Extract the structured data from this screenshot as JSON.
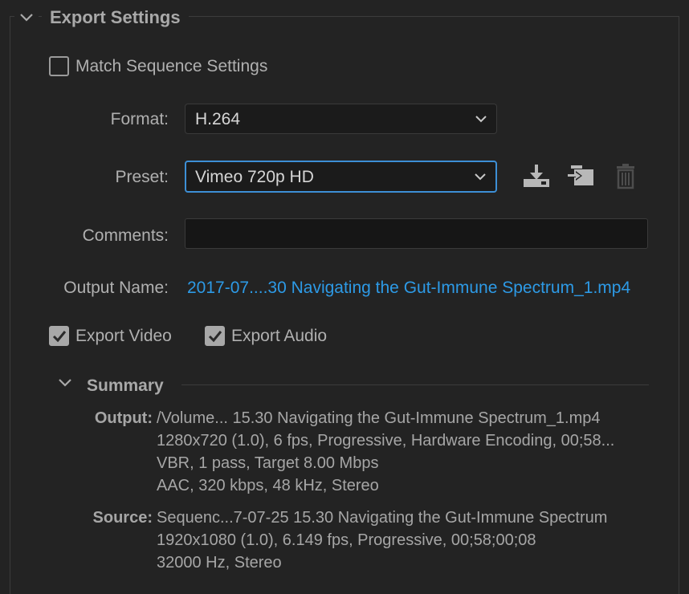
{
  "panel": {
    "title": "Export Settings",
    "match_sequence": {
      "label": "Match Sequence Settings",
      "checked": false
    }
  },
  "format": {
    "label": "Format:",
    "value": "H.264"
  },
  "preset": {
    "label": "Preset:",
    "value": "Vimeo 720p HD"
  },
  "comments": {
    "label": "Comments:",
    "value": ""
  },
  "output_name": {
    "label": "Output Name:",
    "value": "2017-07....30 Navigating the Gut-Immune Spectrum_1.mp4"
  },
  "export_video": {
    "label": "Export Video",
    "checked": true
  },
  "export_audio": {
    "label": "Export Audio",
    "checked": true
  },
  "summary": {
    "title": "Summary",
    "output_key": "Output:",
    "output_lines": [
      "/Volume... 15.30 Navigating the Gut-Immune Spectrum_1.mp4",
      "1280x720 (1.0), 6 fps, Progressive, Hardware Encoding, 00;58...",
      "VBR, 1 pass, Target 8.00 Mbps",
      "AAC, 320 kbps, 48 kHz, Stereo"
    ],
    "source_key": "Source:",
    "source_lines": [
      "Sequenc...7-07-25 15.30 Navigating the Gut-Immune Spectrum",
      "1920x1080 (1.0), 6.149 fps, Progressive, 00;58;00;08",
      "32000 Hz, Stereo"
    ]
  },
  "icons": {
    "save_preset": "save-preset-icon",
    "import_preset": "import-preset-icon",
    "delete_preset": "trash-icon"
  },
  "colors": {
    "accent": "#3d8fd6",
    "link": "#2d9ae6",
    "background": "#232323"
  }
}
